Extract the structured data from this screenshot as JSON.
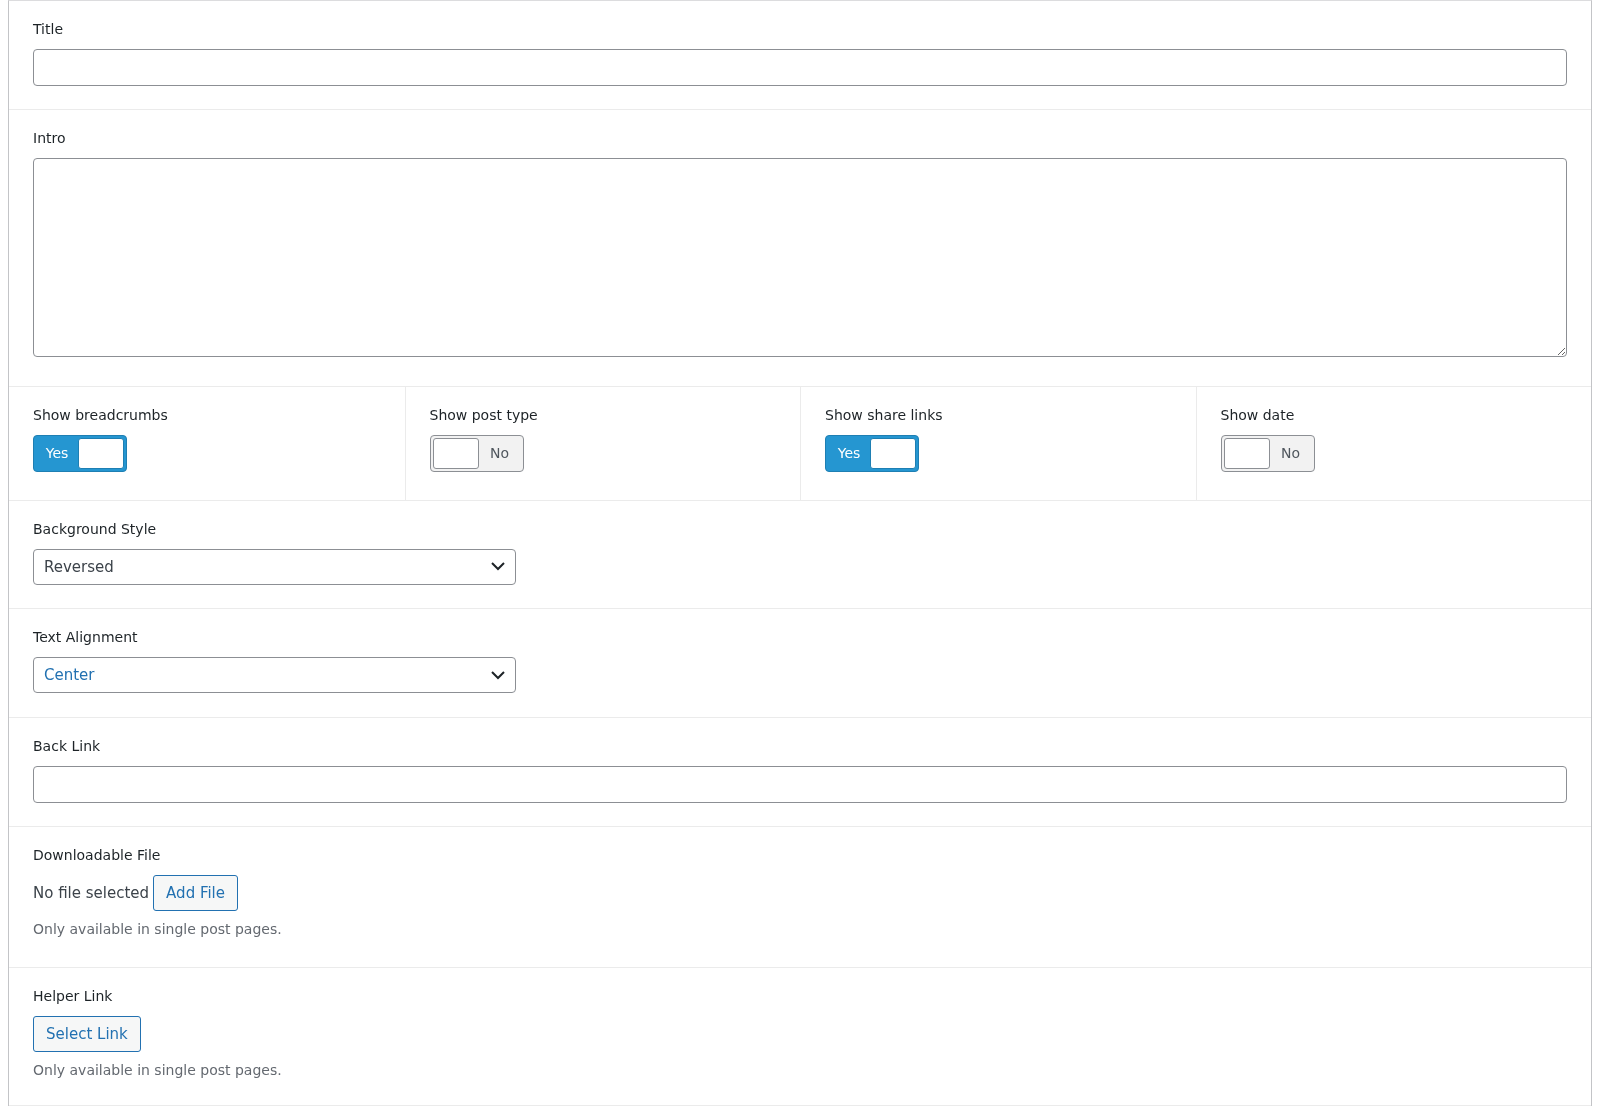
{
  "sections": [
    {
      "kind": "text",
      "label": "Title"
    },
    {
      "kind": "textarea",
      "label": "Intro"
    },
    {
      "kind": "toggles",
      "toggles": [
        {
          "label": "Show breadcrumbs",
          "on": true,
          "state_text": "Yes"
        },
        {
          "label": "Show post type",
          "on": false,
          "state_text": "No"
        },
        {
          "label": "Show share links",
          "on": true,
          "state_text": "Yes"
        },
        {
          "label": "Show date",
          "on": false,
          "state_text": "No"
        }
      ]
    },
    {
      "kind": "select",
      "label": "Background Style",
      "value": "Reversed",
      "highlighted": false
    },
    {
      "kind": "select",
      "label": "Text Alignment",
      "value": "Center",
      "highlighted": true
    },
    {
      "kind": "text",
      "label": "Back Link"
    },
    {
      "kind": "file",
      "label": "Downloadable File",
      "status": "No file selected",
      "button": "Add File",
      "help": "Only available in single post pages."
    },
    {
      "kind": "link",
      "label": "Helper Link",
      "button": "Select Link",
      "help": "Only available in single post pages."
    }
  ]
}
